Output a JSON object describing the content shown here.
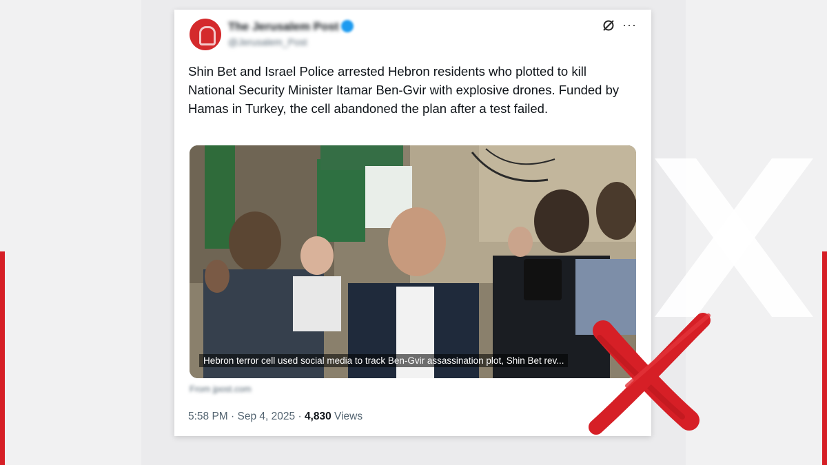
{
  "post": {
    "account_name": "The Jerusalem Post",
    "handle": "@Jerusalem_Post",
    "text": "Shin Bet and Israel Police arrested Hebron residents who plotted to kill National Security Minister Itamar Ben-Gvir with explosive drones. Funded by Hamas in Turkey, the cell abandoned the plan after a test failed.",
    "media_caption": "Hebron terror cell used social media to track Ben-Gvir assassination plot, Shin Bet rev...",
    "source_domain": "From jpost.com",
    "time": "5:58 PM",
    "date": "Sep 4, 2025",
    "views_count": "4,830",
    "views_label": "Views",
    "more_label": "···",
    "separator": "·"
  },
  "icons": {
    "avatar": "jpost-logo-icon",
    "verified": "verified-badge-icon",
    "grok": "grok-icon",
    "more": "more-options-icon",
    "stamp": "red-x-mark"
  },
  "colors": {
    "accent_red": "#d61f26",
    "verified_blue": "#1d9bf0",
    "text_primary": "#0f1419",
    "text_secondary": "#536471"
  }
}
